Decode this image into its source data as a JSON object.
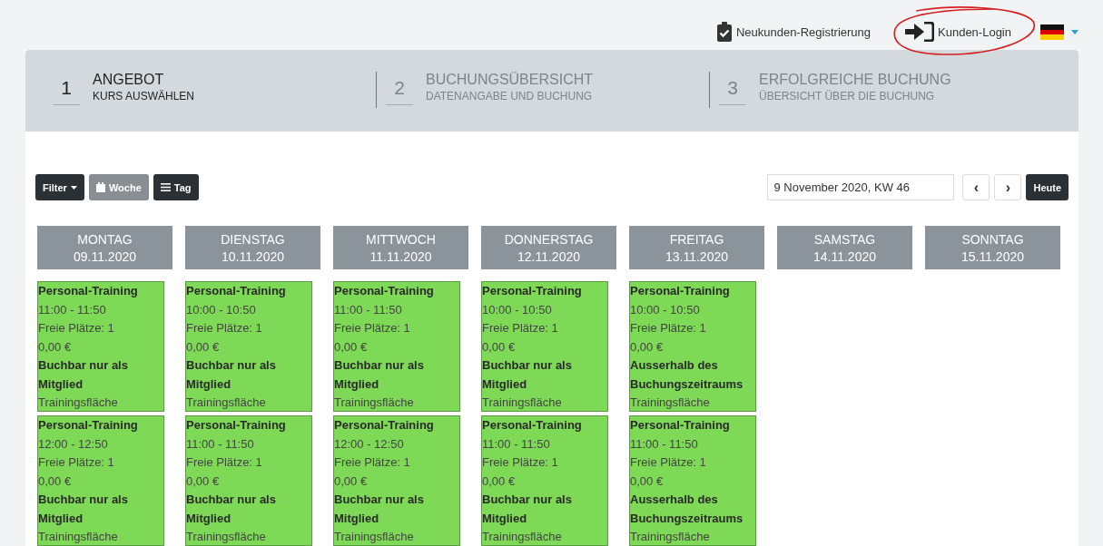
{
  "top_links": [
    {
      "kind": "register",
      "label": "Neukunden-Registrierung"
    },
    {
      "kind": "login",
      "label": "Kunden-Login"
    }
  ],
  "steps": [
    {
      "number": "1",
      "title": "ANGEBOT",
      "subtitle": "KURS AUSWÄHLEN",
      "selected": true
    },
    {
      "number": "2",
      "title": "BUCHUNGSÜBERSICHT",
      "subtitle": "DATENANGABE UND BUCHUNG",
      "selected": false
    },
    {
      "number": "3",
      "title": "ERFOLGREICHE BUCHUNG",
      "subtitle": "ÜBERSICHT ÜBER DIE BUCHUNG",
      "selected": false
    }
  ],
  "toolbar": {
    "filter": "Filter",
    "views": [
      {
        "kind": "week",
        "label": "Woche",
        "selected": true
      },
      {
        "kind": "day",
        "label": "Tag",
        "selected": false
      }
    ],
    "date": "9 November 2020, KW 46",
    "prev": "‹",
    "next": "›",
    "today": "Heute"
  },
  "days": [
    {
      "name": "MONTAG",
      "date": "09.11.2020",
      "courses": [
        {
          "title": "Personal-Training",
          "time": "11:00 - 11:50",
          "seats": "Freie Plätze: 1",
          "price": "0,00 €",
          "status": "Buchbar nur als Mitglied",
          "location": "Trainingsfläche"
        },
        {
          "title": "Personal-Training",
          "time": "12:00 - 12:50",
          "seats": "Freie Plätze: 1",
          "price": "0,00 €",
          "status": "Buchbar nur als Mitglied",
          "location": "Trainingsfläche"
        }
      ]
    },
    {
      "name": "DIENSTAG",
      "date": "10.11.2020",
      "courses": [
        {
          "title": "Personal-Training",
          "time": "10:00 - 10:50",
          "seats": "Freie Plätze: 1",
          "price": "0,00 €",
          "status": "Buchbar nur als Mitglied",
          "location": "Trainingsfläche"
        },
        {
          "title": "Personal-Training",
          "time": "11:00 - 11:50",
          "seats": "Freie Plätze: 1",
          "price": "0,00 €",
          "status": "Buchbar nur als Mitglied",
          "location": "Trainingsfläche"
        }
      ]
    },
    {
      "name": "MITTWOCH",
      "date": "11.11.2020",
      "courses": [
        {
          "title": "Personal-Training",
          "time": "11:00 - 11:50",
          "seats": "Freie Plätze: 1",
          "price": "0,00 €",
          "status": "Buchbar nur als Mitglied",
          "location": "Trainingsfläche"
        },
        {
          "title": "Personal-Training",
          "time": "12:00 - 12:50",
          "seats": "Freie Plätze: 1",
          "price": "0,00 €",
          "status": "Buchbar nur als Mitglied",
          "location": "Trainingsfläche"
        }
      ]
    },
    {
      "name": "DONNERSTAG",
      "date": "12.11.2020",
      "courses": [
        {
          "title": "Personal-Training",
          "time": "10:00 - 10:50",
          "seats": "Freie Plätze: 1",
          "price": "0,00 €",
          "status": "Buchbar nur als Mitglied",
          "location": "Trainingsfläche"
        },
        {
          "title": "Personal-Training",
          "time": "11:00 - 11:50",
          "seats": "Freie Plätze: 1",
          "price": "0,00 €",
          "status": "Buchbar nur als Mitglied",
          "location": "Trainingsfläche"
        }
      ]
    },
    {
      "name": "FREITAG",
      "date": "13.11.2020",
      "courses": [
        {
          "title": "Personal-Training",
          "time": "10:00 - 10:50",
          "seats": "Freie Plätze: 1",
          "price": "0,00 €",
          "status": "Ausserhalb des Buchungszeitraums",
          "location": "Trainingsfläche"
        },
        {
          "title": "Personal-Training",
          "time": "11:00 - 11:50",
          "seats": "Freie Plätze: 1",
          "price": "0,00 €",
          "status": "Ausserhalb des Buchungszeitraums",
          "location": "Trainingsfläche"
        }
      ]
    },
    {
      "name": "SAMSTAG",
      "date": "14.11.2020"
    },
    {
      "name": "SONNTAG",
      "date": "15.11.2020"
    }
  ]
}
